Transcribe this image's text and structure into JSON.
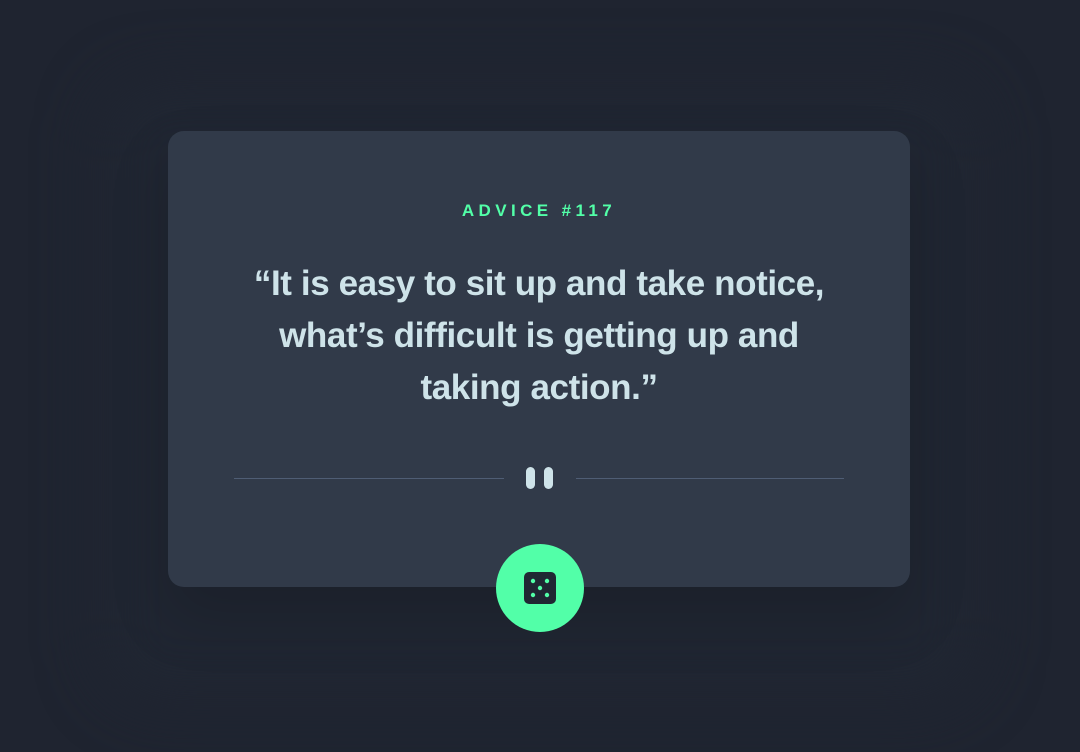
{
  "advice": {
    "id_label": "ADVICE #117",
    "quote": "“It is easy to sit up and take notice, what’s difficult is getting up and taking action.”"
  },
  "icons": {
    "divider": "pause-icon",
    "button": "dice-icon"
  },
  "colors": {
    "background": "#1f2430",
    "card": "#313a49",
    "accent": "#52ffa8",
    "text": "#cee3e9",
    "divider": "#4f5d74"
  }
}
